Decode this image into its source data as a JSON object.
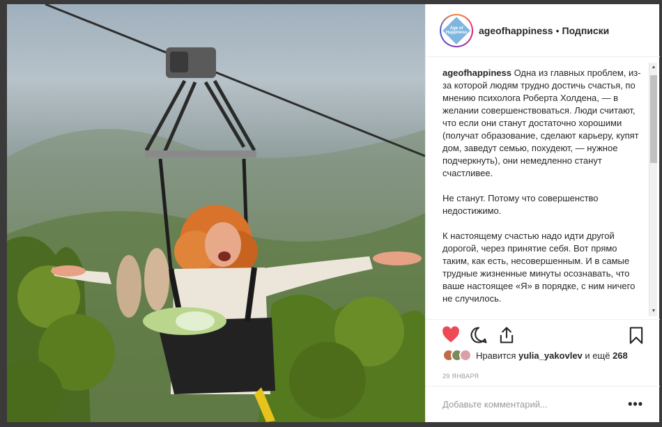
{
  "post": {
    "username": "ageofhappiness",
    "separator": "•",
    "follow_label": "Подписки",
    "avatar_text": "Age of Happiness",
    "caption_user": "ageofhappiness",
    "caption_paragraphs": [
      "Одна из главных проблем, из-за которой людям трудно достичь счастья, по мнению психолога Роберта Холдена, — в желании совершенствоваться. Люди считают, что если они станут достаточно хорошими (получат образование, сделают карьеру, купят дом, заведут семью, похудеют, — нужное подчеркнуть), они немедленно станут счастливее.",
      "Не станут. Потому что совершенство недостижимо.",
      "К настоящему счастью надо идти другой дорогой, через принятие себя. Вот прямо таким, как есть, несовершенным. И в самые трудные жизненные минуты осознавать, что ваше настоящее «Я» в порядке, с ним ничего не случилось."
    ],
    "likes_prefix": "Нравится",
    "likes_user": "yulia_yakovlev",
    "likes_middle": "и ещё",
    "likes_count": "268",
    "date": "29 января",
    "comment_placeholder": "Добавьте комментарий...",
    "more_label": "•••",
    "scroll_up": "▲",
    "scroll_down": "▼"
  },
  "icons": {
    "like": "heart-icon",
    "comment": "comment-icon",
    "share": "share-icon",
    "save": "bookmark-icon"
  },
  "colors": {
    "like_red": "#ed4956",
    "text": "#262626",
    "muted": "#999999"
  }
}
